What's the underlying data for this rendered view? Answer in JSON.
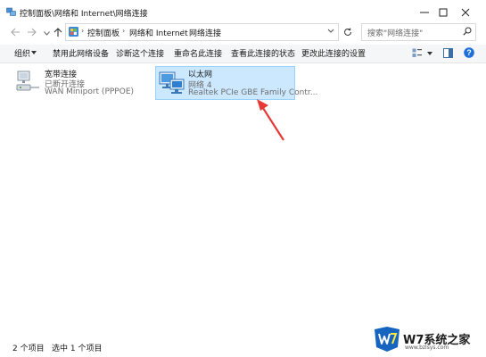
{
  "window": {
    "title": "控制面板\\网络和 Internet\\网络连接",
    "controls": {
      "minimize": "minimize-icon",
      "maximize": "maximize-icon",
      "close": "close-icon"
    }
  },
  "address": {
    "crumbs": [
      "控制面板",
      "网络和 Internet",
      "网络连接"
    ]
  },
  "search": {
    "placeholder": "搜索\"网络连接\""
  },
  "toolbar": {
    "organize": "组织",
    "disable": "禁用此网络设备",
    "diagnose": "诊断这个连接",
    "rename": "重命名此连接",
    "status": "查看此连接的状态",
    "settings": "更改此连接的设置"
  },
  "connections": [
    {
      "name": "宽带连接",
      "status": "已断开连接",
      "device": "WAN Miniport (PPPOE)",
      "selected": false
    },
    {
      "name": "以太网",
      "status": "网络 4",
      "device": "Realtek PCIe GBE Family Contr...",
      "selected": true
    }
  ],
  "statusbar": {
    "count": "2 个项目",
    "selected": "选中 1 个项目"
  },
  "watermark": {
    "brand": "W7系统之家",
    "url": "www.bzlsys.com"
  },
  "colors": {
    "selection": "#cce8ff",
    "selection_border": "#99d1ff",
    "arrow": "#e53935",
    "help": "#1e6fd9"
  }
}
